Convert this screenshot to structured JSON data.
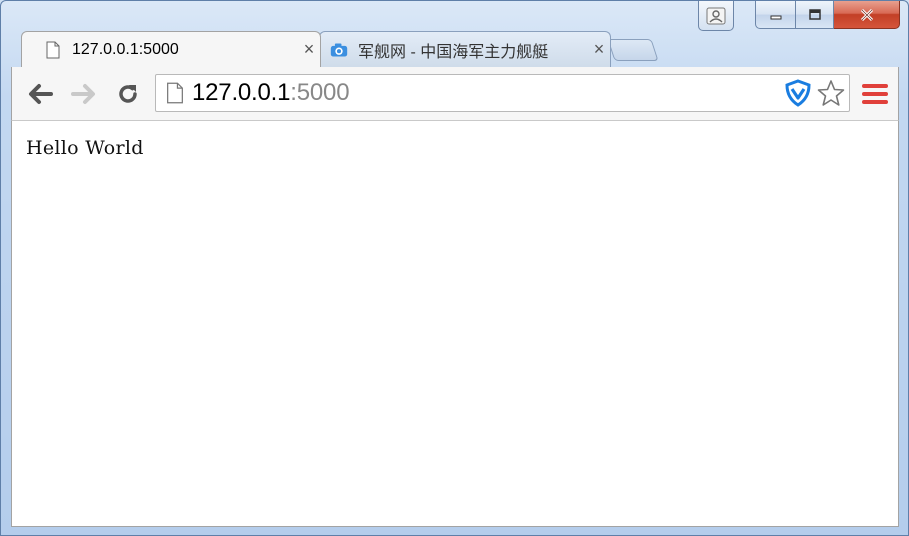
{
  "window": {
    "controls": {
      "minimize_icon": "minimize-icon",
      "maximize_icon": "maximize-icon",
      "close_icon": "close-icon"
    }
  },
  "tabs": [
    {
      "title": "127.0.0.1:5000",
      "icon": "page-icon",
      "active": true
    },
    {
      "title": "军舰网 - 中国海军主力舰艇",
      "icon": "camera-icon",
      "active": false
    }
  ],
  "toolbar": {
    "back_icon": "back-arrow-icon",
    "forward_icon": "forward-arrow-icon",
    "reload_icon": "reload-icon",
    "url_host": "127.0.0.1",
    "url_port": ":5000",
    "shield_icon": "shield-icon",
    "star_icon": "star-icon",
    "menu_icon": "hamburger-menu-icon"
  },
  "page": {
    "text": "Hello World"
  },
  "colors": {
    "menu_accent": "#e0403a",
    "shield_accent": "#1a7de0",
    "close_button": "#c84a33"
  }
}
